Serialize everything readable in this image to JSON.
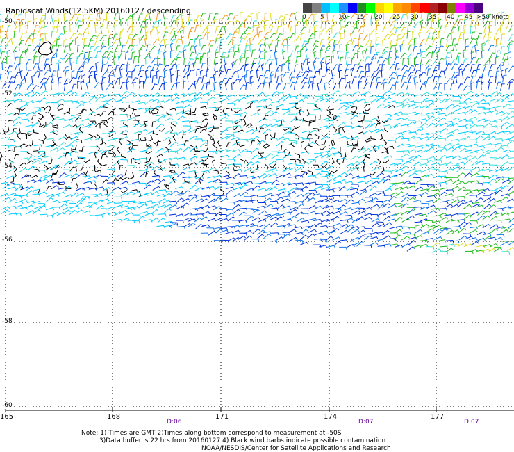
{
  "title": "Rapidscat Winds(12.5KM) 20160127 descending",
  "legend": {
    "ticks": [
      "0",
      "5",
      "10",
      "15",
      "20",
      "25",
      "30",
      "35",
      "40",
      "45"
    ],
    "unit": ">50 knots",
    "colors": [
      "#444444",
      "#808080",
      "#00bfff",
      "#00ffff",
      "#1e90ff",
      "#0000ff",
      "#228b22",
      "#00ff00",
      "#ffd700",
      "#ffff00",
      "#ffa500",
      "#ff8c00",
      "#ff4500",
      "#ff0000",
      "#b22222",
      "#8b0000",
      "#808000",
      "#ff00ff",
      "#9400d3",
      "#4b0082"
    ]
  },
  "axes": {
    "lat_labels": [
      "-50",
      "-52",
      "-54",
      "-56",
      "-58",
      "-60"
    ],
    "lon_labels": [
      "165",
      "168",
      "171",
      "174",
      "177"
    ],
    "time_labels": [
      "D:06",
      "D:07",
      "D:07"
    ]
  },
  "notes": {
    "line1": "Note: 1) Times are GMT 2)Times along bottom correspond to measurement at -50S",
    "line2": "3)Data buffer is 22 hrs from 20160127 4) Black wind barbs indicate possible contamination",
    "line3": "NOAA/NESDIS/Center for Satellite Applications and Research"
  },
  "colors": {
    "black_barb": "#000000",
    "light_blue": "#00ccff",
    "cyan": "#33dddd",
    "blue": "#0033dd",
    "mid_blue": "#1177ee",
    "green": "#22bb22",
    "yellow": "#dddd22",
    "orange": "#ee9922",
    "time_label": "#660099",
    "grid": "#000000"
  }
}
